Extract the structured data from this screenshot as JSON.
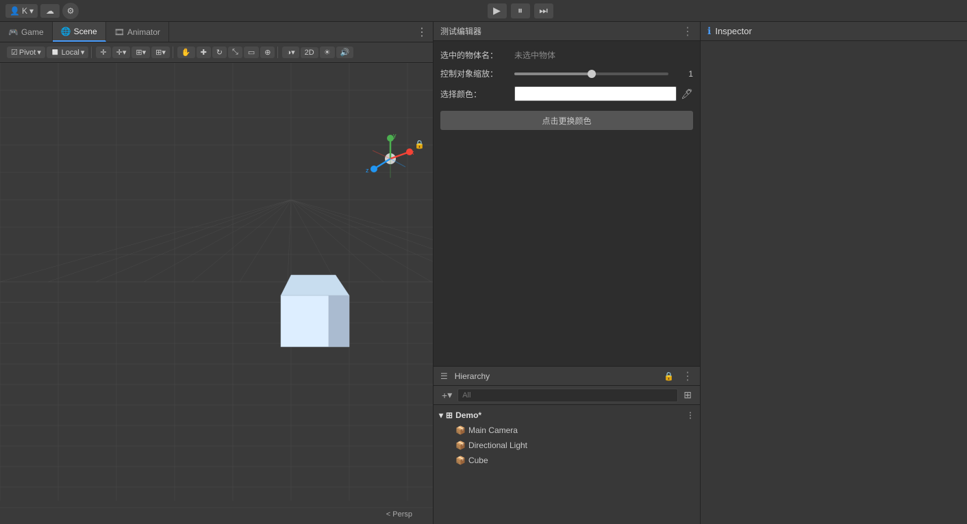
{
  "topbar": {
    "user_label": "K",
    "user_dropdown": "▾",
    "play_icon": "▶",
    "pause_icon": "⏸",
    "step_icon": "⏭"
  },
  "tabs": {
    "game_label": "Game",
    "scene_label": "Scene",
    "animator_label": "Animator",
    "more_icon": "⋮"
  },
  "toolbar": {
    "pivot_label": "Pivot",
    "pivot_dropdown": "▾",
    "local_label": "Local",
    "local_dropdown": "▾"
  },
  "editor_panel": {
    "title": "测试编辑器",
    "more_icon": "⋮",
    "selected_label": "选中的物体名：",
    "selected_value": "未选中物体",
    "scale_label": "控制对象缩放：",
    "scale_value": "1",
    "color_label": "选择颜色：",
    "color_btn_label": "点击更换颜色"
  },
  "hierarchy": {
    "title": "Hierarchy",
    "lock_icon": "🔒",
    "more_icon": "⋮",
    "add_icon": "+",
    "dropdown_icon": "▾",
    "search_placeholder": "All",
    "scene_icon": "⊞",
    "scene_name": "Demo*",
    "expand_icon": "▸",
    "collapse_icon": "▾",
    "items": [
      {
        "name": "Main Camera",
        "icon": "📦"
      },
      {
        "name": "Directional Light",
        "icon": "📦"
      },
      {
        "name": "Cube",
        "icon": "📦"
      }
    ]
  },
  "inspector": {
    "icon": "ℹ",
    "title": "Inspector"
  },
  "viewport": {
    "persp_label": "< Persp"
  }
}
